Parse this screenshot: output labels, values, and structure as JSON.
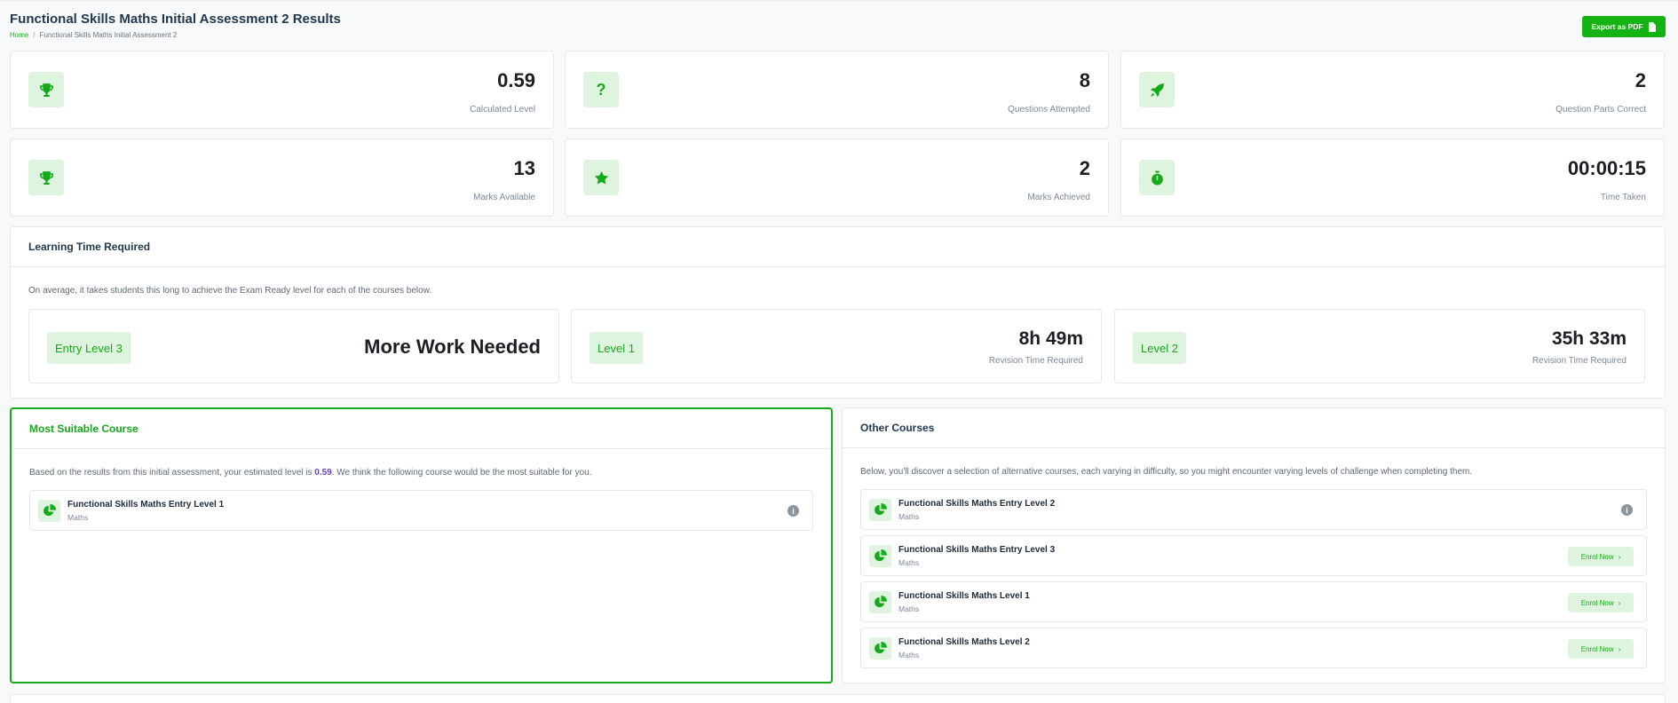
{
  "page": {
    "title": "Functional Skills Maths Initial Assessment 2 Results",
    "breadcrumb": {
      "home": "Home",
      "current": "Functional Skills Maths Initial Assessment 2"
    },
    "export_label": "Export as PDF"
  },
  "stats": [
    {
      "value": "0.59",
      "label": "Calculated Level",
      "icon": "trophy-icon"
    },
    {
      "value": "8",
      "label": "Questions Attempted",
      "icon": "question-icon"
    },
    {
      "value": "2",
      "label": "Question Parts Correct",
      "icon": "rocket-icon"
    },
    {
      "value": "13",
      "label": "Marks Available",
      "icon": "trophy-icon"
    },
    {
      "value": "2",
      "label": "Marks Achieved",
      "icon": "star-icon"
    },
    {
      "value": "00:00:15",
      "label": "Time Taken",
      "icon": "stopwatch-icon"
    }
  ],
  "learning": {
    "title": "Learning Time Required",
    "intro": "On average, it takes students this long to achieve the Exam Ready level for each of the courses below.",
    "levels": [
      {
        "badge": "Entry Level 3",
        "value": "More Work Needed",
        "sub": ""
      },
      {
        "badge": "Level 1",
        "value": "8h 49m",
        "sub": "Revision Time Required"
      },
      {
        "badge": "Level 2",
        "value": "35h 33m",
        "sub": "Revision Time Required"
      }
    ]
  },
  "suitable": {
    "title": "Most Suitable Course",
    "text_before": "Based on the results from this initial assessment, your estimated level is ",
    "level": "0.59",
    "text_after": ". We think the following course would be the most suitable for you.",
    "course": {
      "name": "Functional Skills Maths Entry Level 1",
      "subject": "Maths"
    }
  },
  "other": {
    "title": "Other Courses",
    "intro": "Below, you'll discover a selection of alternative courses, each varying in difficulty, so you might encounter varying levels of challenge when completing them.",
    "enrol_label": "Enrol Now",
    "courses": [
      {
        "name": "Functional Skills Maths Entry Level 2",
        "subject": "Maths"
      },
      {
        "name": "Functional Skills Maths Entry Level 3",
        "subject": "Maths"
      },
      {
        "name": "Functional Skills Maths Level 1",
        "subject": "Maths"
      },
      {
        "name": "Functional Skills Maths Level 2",
        "subject": "Maths"
      }
    ]
  },
  "colors": {
    "accent": "#12b312",
    "accent_soft": "#dff4df",
    "highlight": "#6f42c1"
  }
}
